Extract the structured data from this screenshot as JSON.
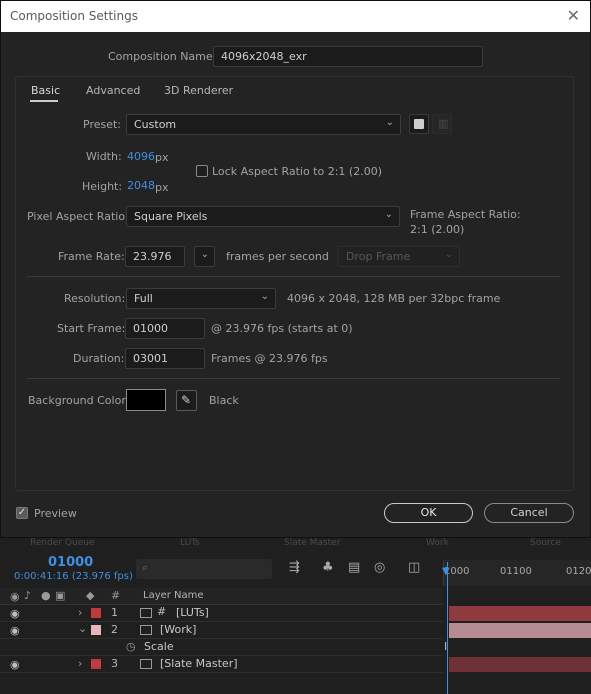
{
  "window": {
    "title": "Composition Settings",
    "close_glyph": "✕"
  },
  "composition_name": {
    "label": "Composition Name:",
    "value": "4096x2048_exr"
  },
  "tabs": [
    {
      "label": "Basic",
      "active": true
    },
    {
      "label": "Advanced",
      "active": false
    },
    {
      "label": "3D Renderer",
      "active": false
    }
  ],
  "preset": {
    "label": "Preset:",
    "value": "Custom",
    "save_icon": "save-preset-icon",
    "delete_icon": "trash-icon"
  },
  "width": {
    "label": "Width:",
    "value": "4096",
    "unit": "px"
  },
  "height": {
    "label": "Height:",
    "value": "2048",
    "unit": "px"
  },
  "lock_aspect": {
    "label": "Lock Aspect Ratio to 2:1 (2.00)",
    "checked": false
  },
  "pixel_aspect": {
    "label": "Pixel Aspect Ratio:",
    "value": "Square Pixels"
  },
  "frame_aspect": {
    "label": "Frame Aspect Ratio:",
    "value": "2:1 (2.00)"
  },
  "frame_rate": {
    "label": "Frame Rate:",
    "value": "23.976",
    "unit": "frames per second",
    "drop_frame": "Drop Frame"
  },
  "resolution": {
    "label": "Resolution:",
    "value": "Full",
    "info": "4096 x 2048, 128 MB per 32bpc frame"
  },
  "start_frame": {
    "label": "Start Frame:",
    "value": "01000",
    "info": "@ 23.976 fps (starts at 0)"
  },
  "duration": {
    "label": "Duration:",
    "value": "03001",
    "info": "Frames @ 23.976 fps"
  },
  "background": {
    "label": "Background Color:",
    "color": "#000000",
    "name": "Black"
  },
  "preview": {
    "label": "Preview",
    "checked": true,
    "check_glyph": "✓"
  },
  "buttons": {
    "ok": "OK",
    "cancel": "Cancel"
  },
  "timeline": {
    "current_frame": "01000",
    "timecode": "0:00:41:16 (23.976 fps)",
    "search_glyph": "⌕",
    "column_hash": "#",
    "column_layer_name": "Layer Name",
    "ruler": [
      "1000",
      "01100",
      "0120"
    ],
    "behind_tabs": [
      "Render Queue",
      "LUTs",
      "Slate Master",
      "Work",
      "Source Frame"
    ],
    "layers": [
      {
        "num": "1",
        "name": "[LUTs]",
        "color": "#c0393b",
        "bar": "#8e3a3e"
      },
      {
        "num": "2",
        "name": "[Work]",
        "color": "#e8b4bd",
        "bar": "#b78b93"
      },
      {
        "num": "",
        "name": "Scale",
        "color": "",
        "bar": ""
      },
      {
        "num": "3",
        "name": "[Slate Master]",
        "color": "#c0393b",
        "bar": "#6e3236"
      }
    ]
  }
}
